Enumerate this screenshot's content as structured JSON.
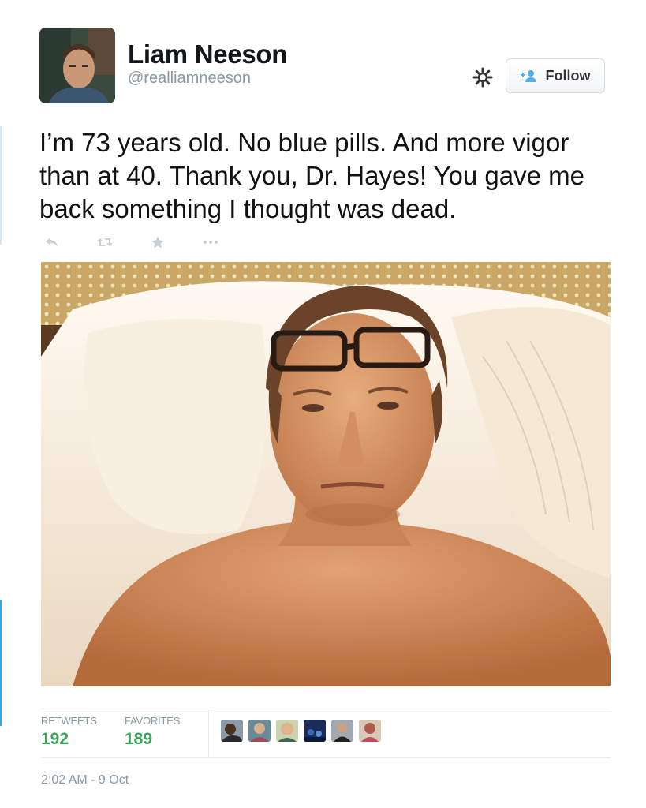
{
  "user": {
    "name": "Liam Neeson",
    "handle": "@realliamneeson"
  },
  "header": {
    "follow_label": "Follow",
    "settings_icon": "gear-icon",
    "follow_icon": "add-user-icon"
  },
  "tweet": {
    "text": "I’m 73 years old. No blue pills. And more vigor than at 40. Thank you, Dr. Hayes! You gave me back something I thought was dead."
  },
  "actions": [
    {
      "icon": "reply-icon"
    },
    {
      "icon": "retweet-icon"
    },
    {
      "icon": "favorite-star-icon"
    },
    {
      "icon": "more-dots-icon"
    }
  ],
  "stats": {
    "retweets_label": "RETWEETS",
    "retweets_count": "192",
    "favorites_label": "FAVORITES",
    "favorites_count": "189"
  },
  "favoriters": [
    "avatar",
    "avatar",
    "avatar",
    "avatar",
    "avatar",
    "avatar"
  ],
  "timestamp": "2:02 AM - 9 Oct",
  "colors": {
    "stat_green": "#3ba55d",
    "muted": "#8899a6",
    "follow_blue": "#55acee"
  }
}
